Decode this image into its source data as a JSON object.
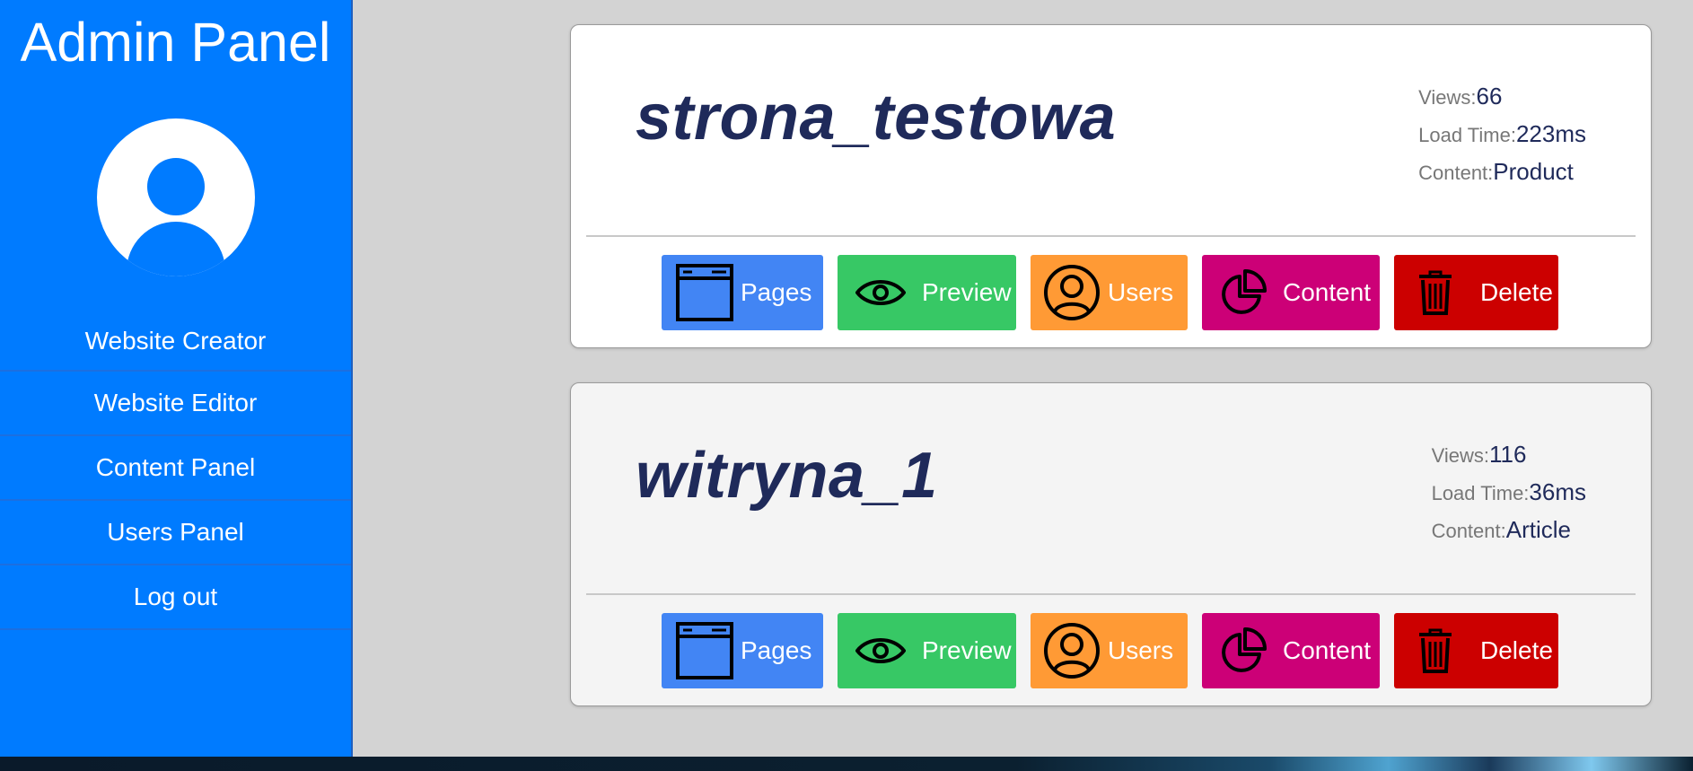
{
  "sidebar": {
    "title": "Admin Panel",
    "nav": [
      {
        "label": "Website Creator"
      },
      {
        "label": "Website Editor"
      },
      {
        "label": "Content Panel"
      },
      {
        "label": "Users Panel"
      },
      {
        "label": "Log out"
      }
    ]
  },
  "sites": [
    {
      "name": "strona_testowa",
      "views_label": "Views:",
      "views": "66",
      "load_label": "Load Time:",
      "load_time": "223ms",
      "content_label": "Content:",
      "content": "Product"
    },
    {
      "name": "witryna_1",
      "views_label": "Views:",
      "views": "116",
      "load_label": "Load Time:",
      "load_time": "36ms",
      "content_label": "Content:",
      "content": "Article"
    }
  ],
  "actions": {
    "pages": "Pages",
    "preview": "Preview",
    "users": "Users",
    "content": "Content",
    "delete": "Delete"
  },
  "colors": {
    "sidebar": "#007bff",
    "pages": "#4285f4",
    "preview": "#37c865",
    "users": "#ff9a35",
    "content": "#cc0077",
    "delete": "#cc0000",
    "title_text": "#1f2a5a"
  },
  "icons": [
    "user-avatar-icon",
    "browser-window-icon",
    "eye-icon",
    "user-circle-icon",
    "pie-chart-icon",
    "trash-icon"
  ]
}
